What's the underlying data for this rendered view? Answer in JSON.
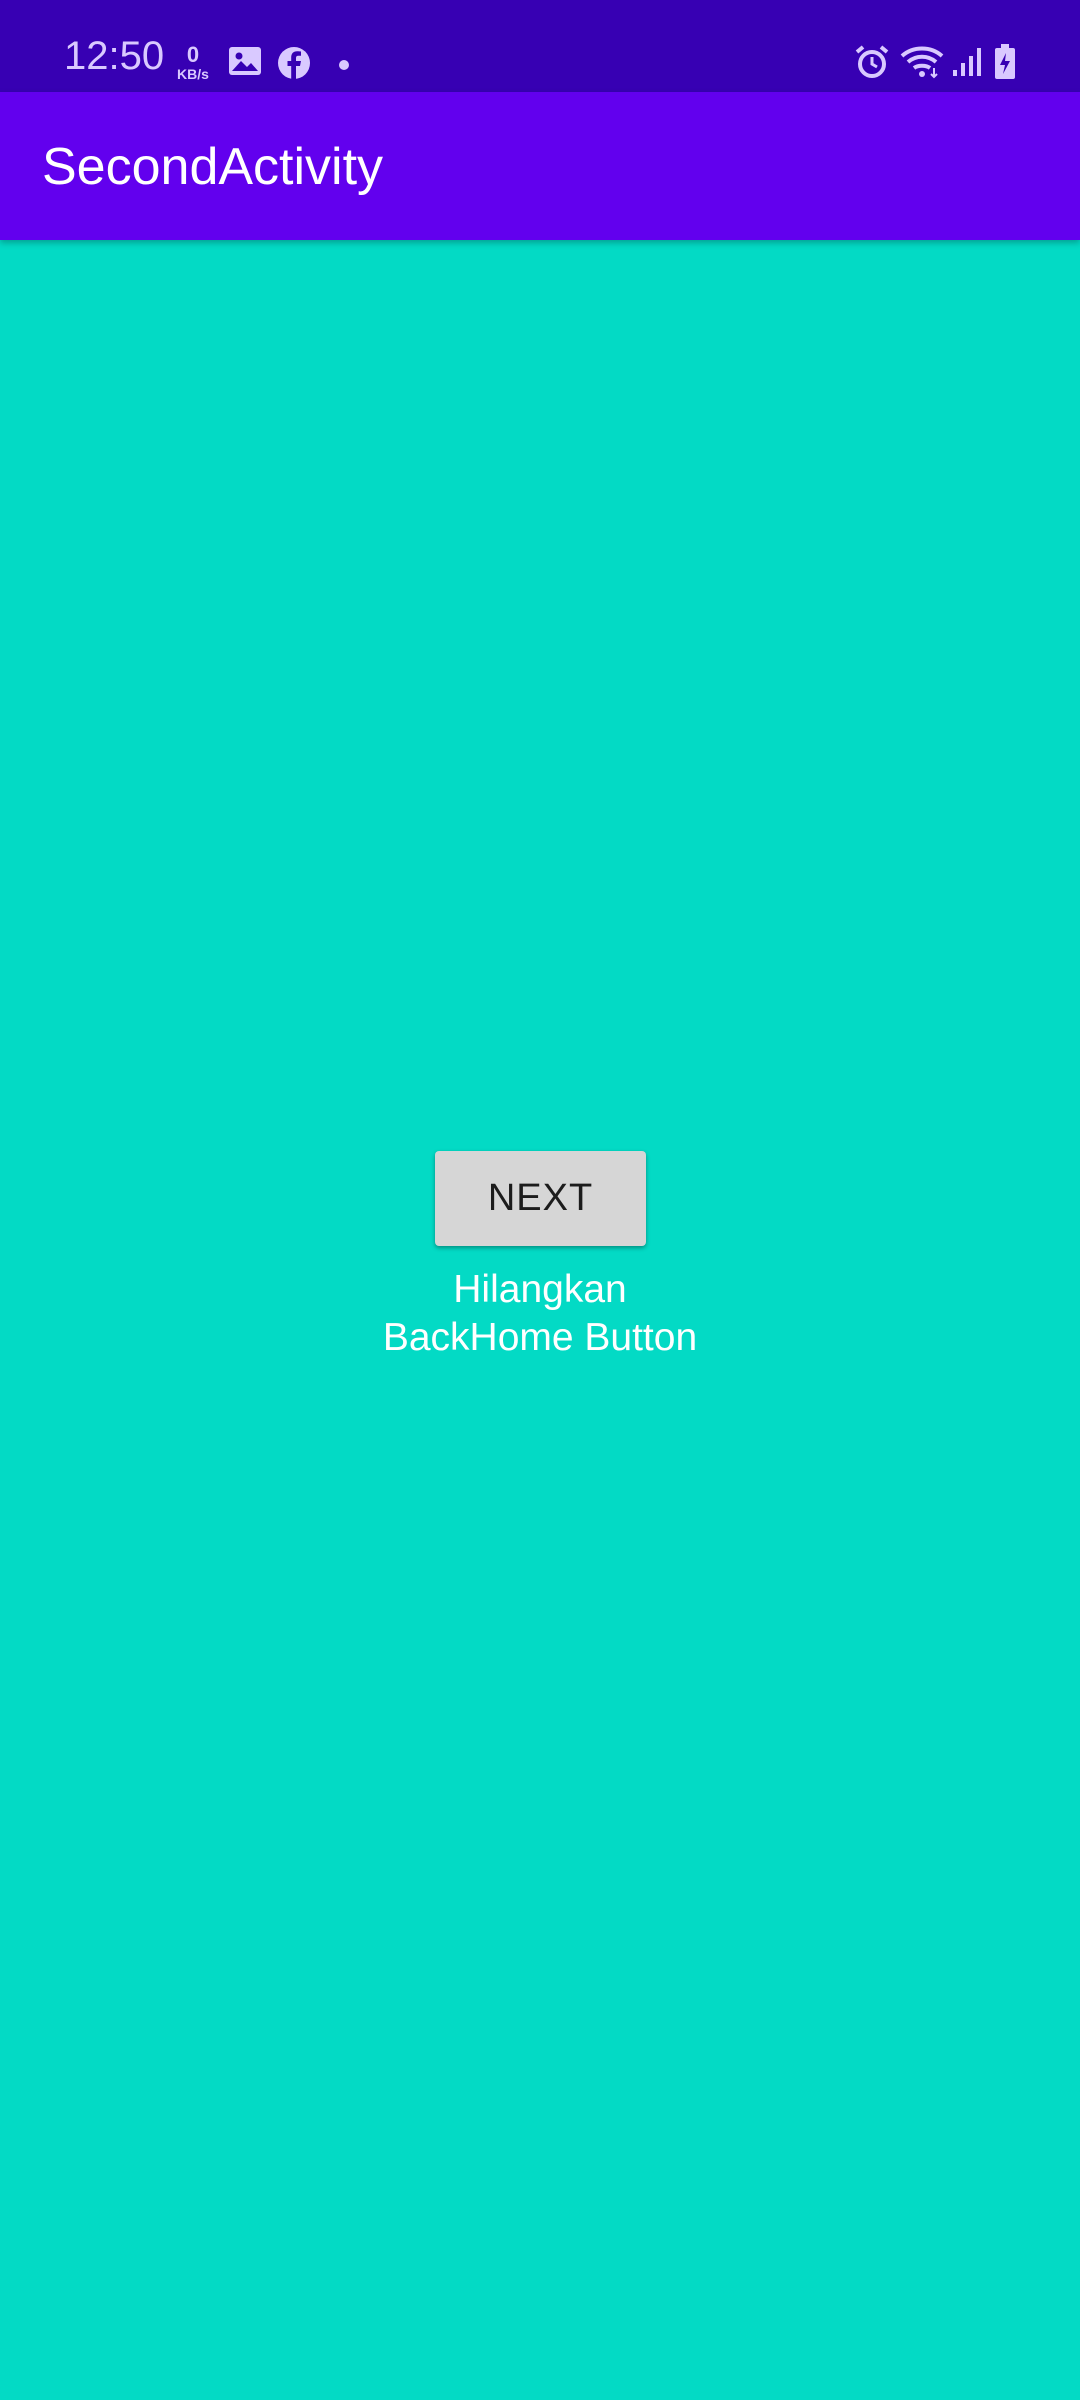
{
  "status_bar": {
    "time": "12:50",
    "net_speed_value": "0",
    "net_speed_unit": "KB/s",
    "left_icons": [
      "gallery-icon",
      "facebook-icon",
      "dot-icon"
    ],
    "right_icons": [
      "alarm-icon",
      "wifi-icon",
      "signal-icon",
      "battery-charging-icon"
    ]
  },
  "app_bar": {
    "title": "SecondActivity"
  },
  "content": {
    "next_button_label": "NEXT",
    "caption_line1": "Hilangkan",
    "caption_line2": "BackHome Button"
  },
  "colors": {
    "status_bar": "#3700B3",
    "app_bar": "#6200EE",
    "background": "#03DAC5",
    "button": "#D6D6D6"
  }
}
